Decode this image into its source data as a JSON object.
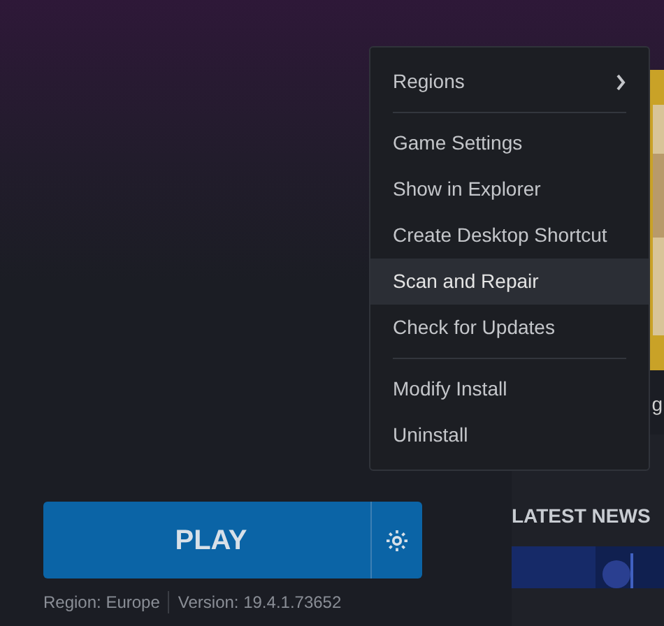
{
  "context_menu": {
    "items": [
      {
        "kind": "submenu",
        "label": "Regions",
        "selected": false
      },
      {
        "kind": "divider"
      },
      {
        "kind": "item",
        "label": "Game Settings",
        "selected": false
      },
      {
        "kind": "item",
        "label": "Show in Explorer",
        "selected": false
      },
      {
        "kind": "item",
        "label": "Create Desktop Shortcut",
        "selected": false
      },
      {
        "kind": "item",
        "label": "Scan and Repair",
        "selected": true
      },
      {
        "kind": "item",
        "label": "Check for Updates",
        "selected": false
      },
      {
        "kind": "divider"
      },
      {
        "kind": "item",
        "label": "Modify Install",
        "selected": false
      },
      {
        "kind": "item",
        "label": "Uninstall",
        "selected": false
      }
    ]
  },
  "game_card": {
    "title": "g"
  },
  "play_button": {
    "label": "PLAY"
  },
  "region": "Region: Europe",
  "version": "Version: 19.4.1.73652",
  "latest_news": {
    "heading": "LATEST NEWS"
  }
}
